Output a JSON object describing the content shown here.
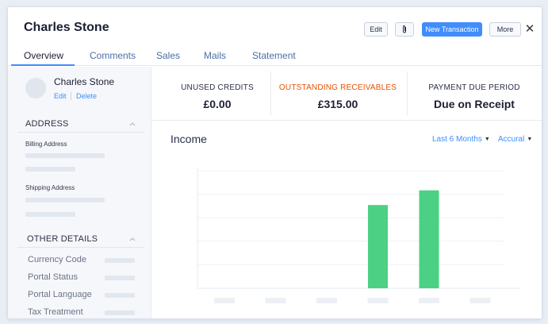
{
  "header": {
    "title": "Charles Stone",
    "edit_label": "Edit",
    "new_transaction_label": "New Transaction",
    "more_label": "More",
    "close_glyph": "✕"
  },
  "tabs": [
    {
      "label": "Overview",
      "active": true
    },
    {
      "label": "Comments",
      "active": false
    },
    {
      "label": "Sales",
      "active": false
    },
    {
      "label": "Mails",
      "active": false
    },
    {
      "label": "Statement",
      "active": false
    }
  ],
  "sidebar": {
    "name": "Charles Stone",
    "edit_link": "Edit",
    "delete_link": "Delete",
    "address_heading": "ADDRESS",
    "billing_label": "Billing Address",
    "shipping_label": "Shipping Address",
    "other_heading": "OTHER DETAILS",
    "other_fields": [
      "Currency Code",
      "Portal Status",
      "Portal Language",
      "Tax Treatment"
    ]
  },
  "summary": [
    {
      "label": "UNUSED CREDITS",
      "value": "£0.00",
      "color": "#2b3047"
    },
    {
      "label": "OUTSTANDING RECEIVABLES",
      "value": "£315.00",
      "color": "#e65100"
    },
    {
      "label": "PAYMENT DUE PERIOD",
      "value": "Due on Receipt",
      "color": "#2b3047"
    }
  ],
  "income": {
    "title": "Income",
    "period_dropdown": "Last 6 Months",
    "basis_dropdown": "Accural"
  },
  "colors": {
    "accent": "#408dfb",
    "bar": "#4cd184",
    "warning": "#e65100"
  },
  "icons": {
    "attach": "paperclip-icon",
    "close": "close-icon",
    "collapse": "chevron-up-icon",
    "dropdown": "caret-down-icon"
  },
  "chart_data": {
    "type": "bar",
    "categories": [
      "",
      "",
      "",
      "",
      "",
      ""
    ],
    "values": [
      0,
      0,
      0,
      85,
      100,
      0
    ],
    "title": "Income",
    "xlabel": "",
    "ylabel": "",
    "ylim": [
      0,
      120
    ],
    "grid": true,
    "tick_labels_visible": false
  }
}
